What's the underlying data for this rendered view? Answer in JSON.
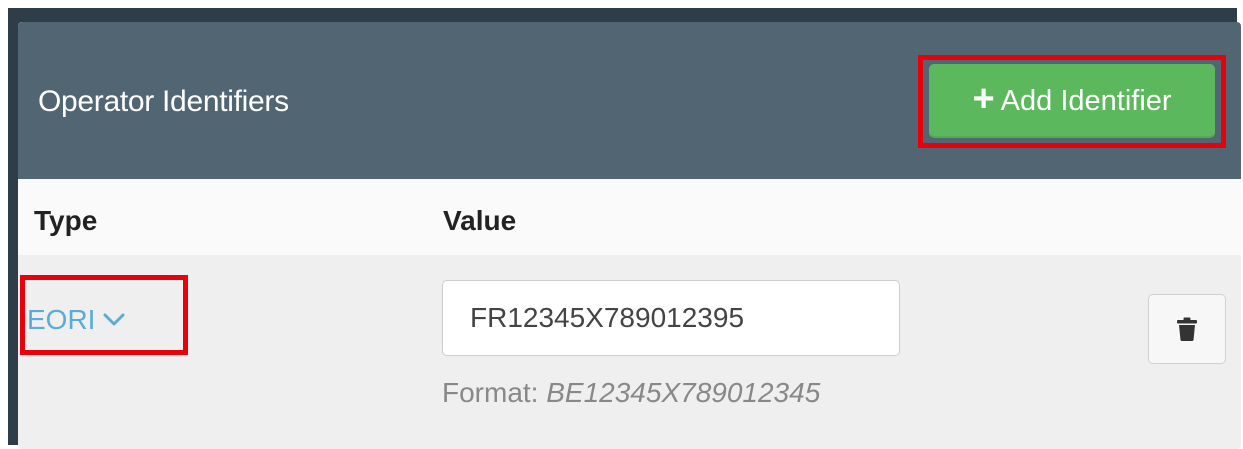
{
  "panel": {
    "title": "Operator Identifiers",
    "add_button": {
      "icon": "plus-icon",
      "label": "Add Identifier"
    }
  },
  "table": {
    "columns": [
      "Type",
      "Value"
    ],
    "rows": [
      {
        "type": "EORI",
        "value": "FR12345X789012395",
        "format_label": "Format: ",
        "format_example": "BE12345X789012345",
        "delete_icon": "trash-icon"
      }
    ]
  },
  "colors": {
    "header_bg": "#526573",
    "add_button_bg": "#5cb85c",
    "link": "#5aabd8",
    "highlight": "#e8000b"
  }
}
